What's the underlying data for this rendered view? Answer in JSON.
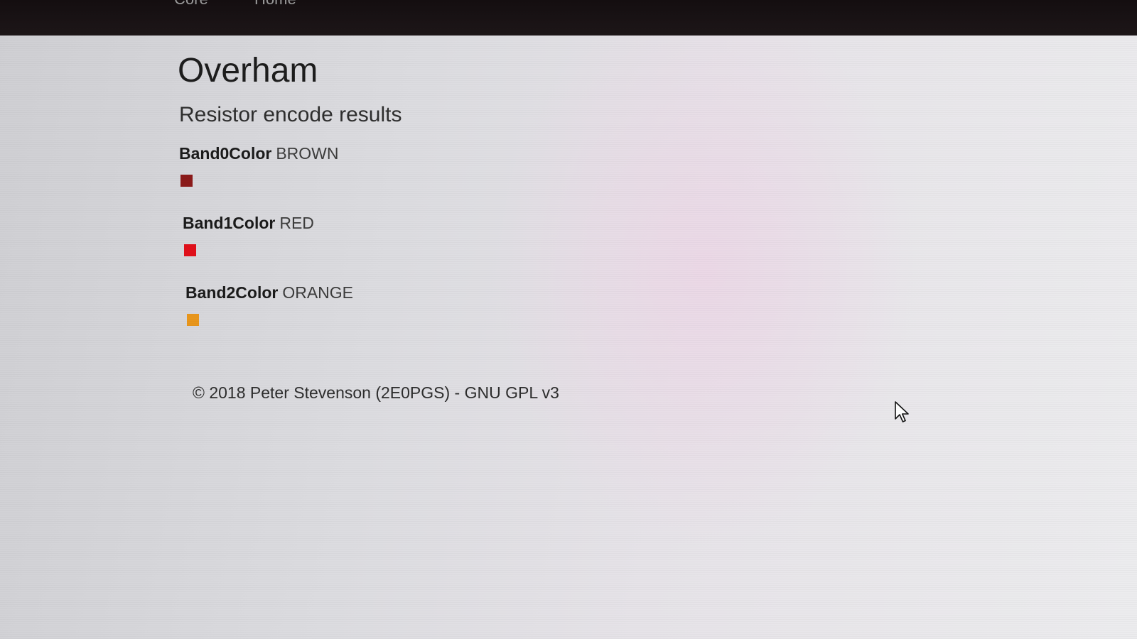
{
  "nav": {
    "items": [
      "Core",
      "Home"
    ]
  },
  "page": {
    "title": "Overham",
    "subtitle": "Resistor encode results"
  },
  "bands": [
    {
      "name": "Band0Color",
      "value": "BROWN",
      "color": "#8b1a1a"
    },
    {
      "name": "Band1Color",
      "value": "RED",
      "color": "#e0101a"
    },
    {
      "name": "Band2Color",
      "value": "ORANGE",
      "color": "#e8961c"
    }
  ],
  "footer": {
    "text": "© 2018 Peter Stevenson (2E0PGS) - GNU GPL v3"
  },
  "icons": {
    "cursor": "mouse-pointer-icon"
  }
}
